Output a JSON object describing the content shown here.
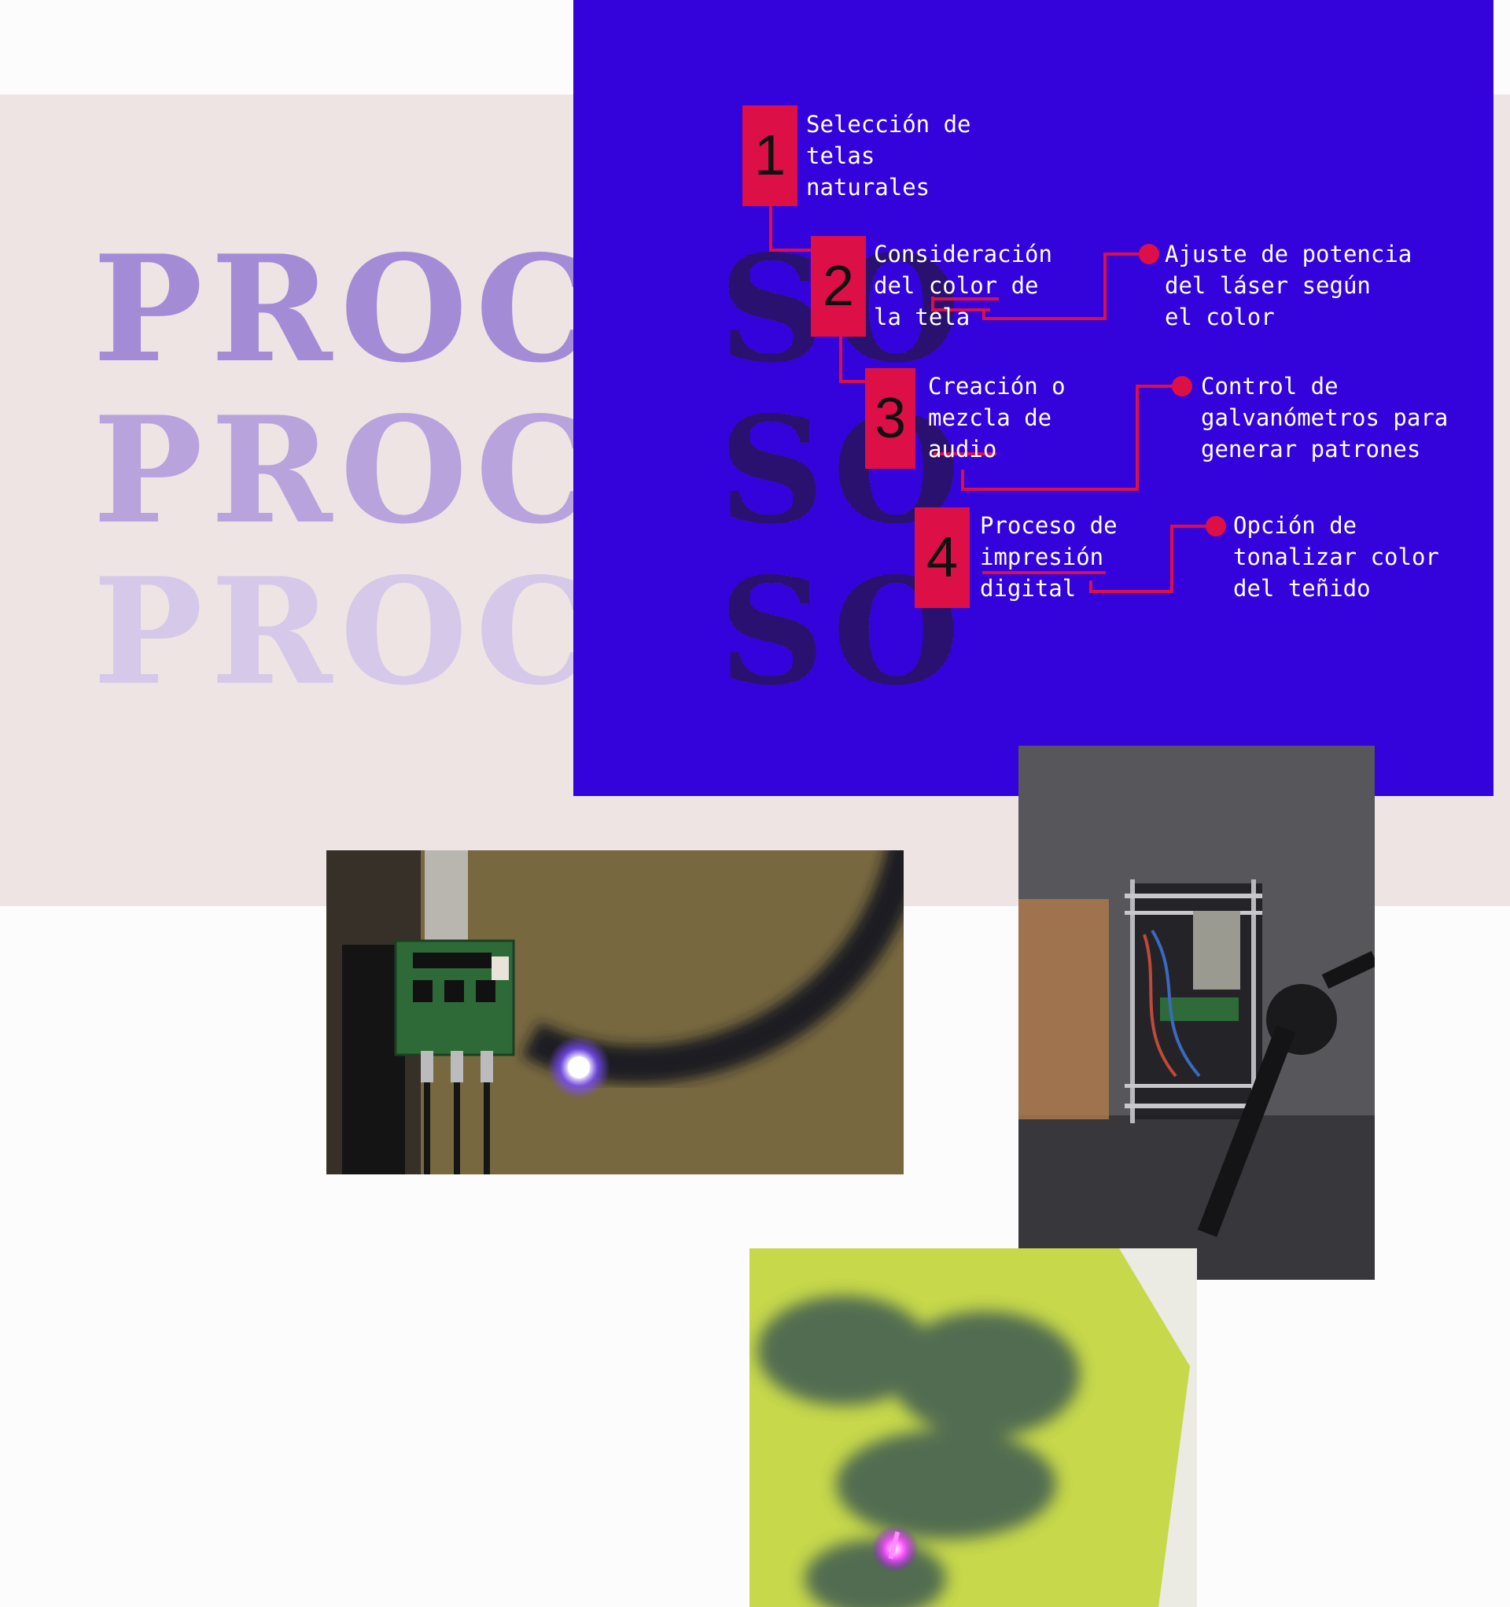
{
  "heading": {
    "word": "PROCESO",
    "lead": "PROCE",
    "tail": "SO"
  },
  "steps": [
    {
      "number": "1",
      "text": "Selección de\ntelas\nnaturales"
    },
    {
      "number": "2",
      "text": "Consideración\ndel color de\nla tela"
    },
    {
      "number": "3",
      "text": "Creación o\nmezcla de\naudio"
    },
    {
      "number": "4",
      "text": "Proceso de\nimpresión\ndigital"
    }
  ],
  "details": [
    {
      "text": "Ajuste de potencia\ndel láser según\nel color"
    },
    {
      "text": "Control de\ngalvanómetros para\ngenerar patrones"
    },
    {
      "text": "Opción de\ntonalizar color\ndel teñido"
    }
  ],
  "colors": {
    "accent": "#dc0f47",
    "panel": "#3402db",
    "band": "#eee4e4"
  },
  "photos": [
    {
      "icon": "circuit-board-photo"
    },
    {
      "icon": "laser-device-photo"
    },
    {
      "icon": "dyed-fabric-photo"
    }
  ]
}
